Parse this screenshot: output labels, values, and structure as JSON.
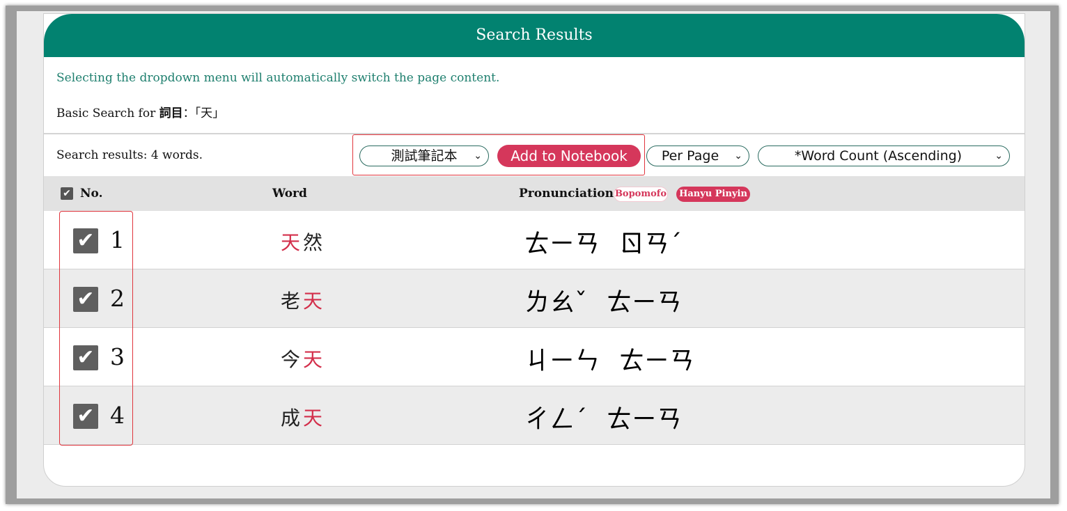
{
  "header": {
    "title": "Search Results"
  },
  "notice": "Selecting the dropdown menu will automatically switch the page content.",
  "basic_search": {
    "prefix": "Basic Search for",
    "field": "詞目",
    "term": "：「天」"
  },
  "results_count": "Search results: 4 words.",
  "toolbar": {
    "notebook_select": "測試筆記本",
    "add_button": "Add to Notebook",
    "per_page_select": "Per Page",
    "sort_select": "*Word Count (Ascending)"
  },
  "table": {
    "headers": {
      "no": "No.",
      "word": "Word",
      "pronunciation": "Pronunciation"
    },
    "tags": {
      "bopomofo": "Bopomofo",
      "pinyin": "Hanyu Pinyin"
    },
    "rows": [
      {
        "no": "1",
        "pre": "",
        "hl": "天",
        "post": "然",
        "syl1": "ㄊㄧㄢ",
        "syl2": "ㄖㄢˊ",
        "checked": true
      },
      {
        "no": "2",
        "pre": "老",
        "hl": "天",
        "post": "",
        "syl1": "ㄌㄠˇ",
        "syl2": "ㄊㄧㄢ",
        "checked": true
      },
      {
        "no": "3",
        "pre": "今",
        "hl": "天",
        "post": "",
        "syl1": "ㄐㄧㄣ",
        "syl2": "ㄊㄧㄢ",
        "checked": true
      },
      {
        "no": "4",
        "pre": "成",
        "hl": "天",
        "post": "",
        "syl1": "ㄔㄥˊ",
        "syl2": "ㄊㄧㄢ",
        "checked": true
      }
    ]
  },
  "colors": {
    "header": "#028270",
    "accent": "#d5375b",
    "highlight_box": "#e0353d"
  }
}
